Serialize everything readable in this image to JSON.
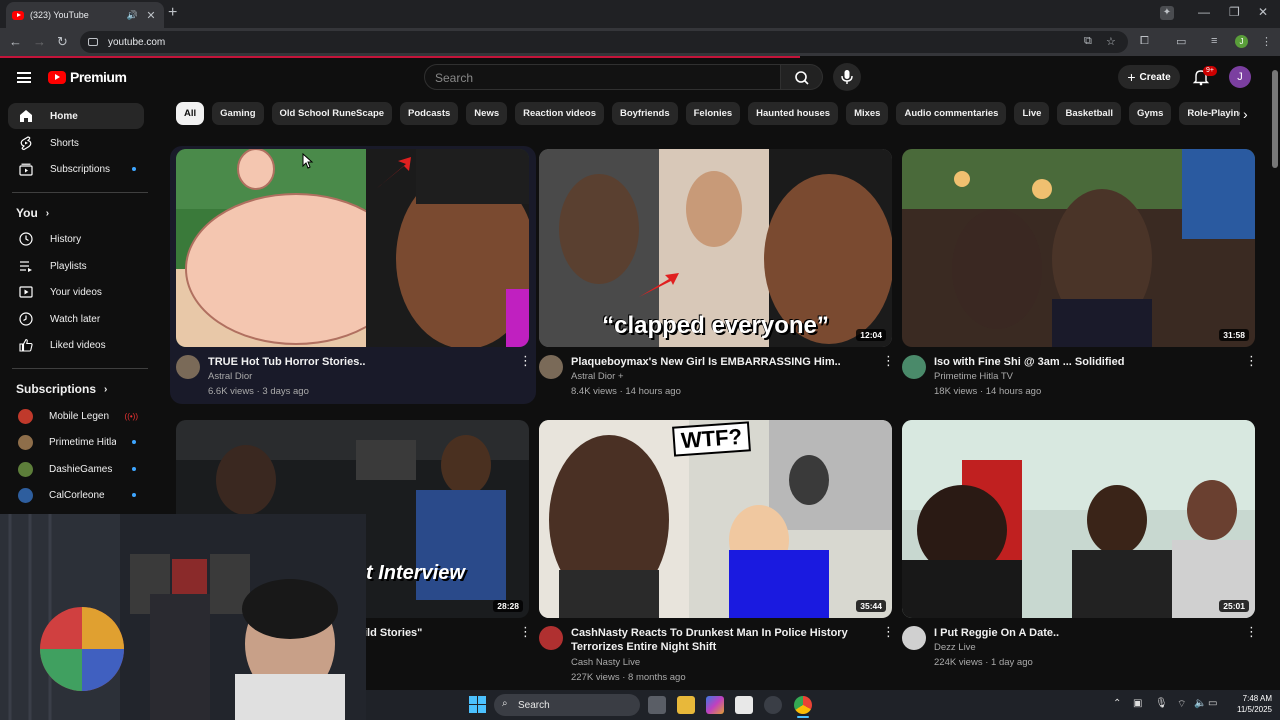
{
  "browser": {
    "tab_title": "(323) YouTube",
    "url": "youtube.com",
    "profile_initial": "J"
  },
  "header": {
    "logo_text": "Premium",
    "search_placeholder": "Search",
    "create_label": "Create",
    "notification_badge": "9+",
    "avatar_initial": "J"
  },
  "sidebar": {
    "main": [
      {
        "label": "Home",
        "icon": "home-icon"
      },
      {
        "label": "Shorts",
        "icon": "shorts-icon"
      },
      {
        "label": "Subscriptions",
        "icon": "subscriptions-icon"
      }
    ],
    "you_header": "You",
    "you": [
      {
        "label": "History",
        "icon": "history-icon"
      },
      {
        "label": "Playlists",
        "icon": "playlists-icon"
      },
      {
        "label": "Your videos",
        "icon": "your-videos-icon"
      },
      {
        "label": "Watch later",
        "icon": "watch-later-icon"
      },
      {
        "label": "Liked videos",
        "icon": "liked-videos-icon"
      }
    ],
    "subscriptions_header": "Subscriptions",
    "subscriptions": [
      {
        "label": "Mobile Legends: ...",
        "color": "#c0392b"
      },
      {
        "label": "Primetime Hitla ...",
        "color": "#8e6e4a"
      },
      {
        "label": "DashieGames",
        "color": "#5d7e3a"
      },
      {
        "label": "CalCorleone",
        "color": "#2e5e9e"
      }
    ]
  },
  "chips": [
    "All",
    "Gaming",
    "Old School RuneScape",
    "Podcasts",
    "News",
    "Reaction videos",
    "Boyfriends",
    "Felonies",
    "Haunted houses",
    "Mixes",
    "Audio commentaries",
    "Live",
    "Basketball",
    "Gyms",
    "Role-Playing Games"
  ],
  "videos": [
    {
      "title": "TRUE Hot Tub Horror Stories..",
      "channel": "Astral Dior",
      "views": "6.6K views",
      "age": "3 days ago",
      "duration": "",
      "avatar_color": "#7a6a58"
    },
    {
      "title": "Plaqueboymax's New Girl Is EMBARRASSING Him..",
      "channel": "Astral Dior +",
      "views": "8.4K views",
      "age": "14 hours ago",
      "duration": "12:04",
      "overlay_text": "“clapped everyone”",
      "avatar_color": "#7a6a58"
    },
    {
      "title": "Iso with Fine Shi @ 3am ... Solidified",
      "channel": "Primetime Hitla TV",
      "views": "18K views",
      "age": "14 hours ago",
      "duration": "31:58",
      "avatar_color": "#4a8a6a"
    },
    {
      "title": "ild Stories\"",
      "channel": "",
      "views": "",
      "age": "",
      "duration": "28:28",
      "overlay_text": "t Interview",
      "avatar_color": "#555"
    },
    {
      "title": "CashNasty Reacts To Drunkest Man In Police History Terrorizes Entire Night Shift",
      "channel": "Cash Nasty Live",
      "views": "227K views",
      "age": "8 months ago",
      "duration": "35:44",
      "overlay_text": "WTF?",
      "avatar_color": "#b03030"
    },
    {
      "title": "I Put Reggie On A Date..",
      "channel": "Dezz Live",
      "views": "224K views",
      "age": "1 day ago",
      "duration": "25:01",
      "avatar_color": "#d0d0d0"
    }
  ],
  "taskbar": {
    "search_label": "Search",
    "time": "7:48 AM",
    "date": "11/5/2025"
  }
}
